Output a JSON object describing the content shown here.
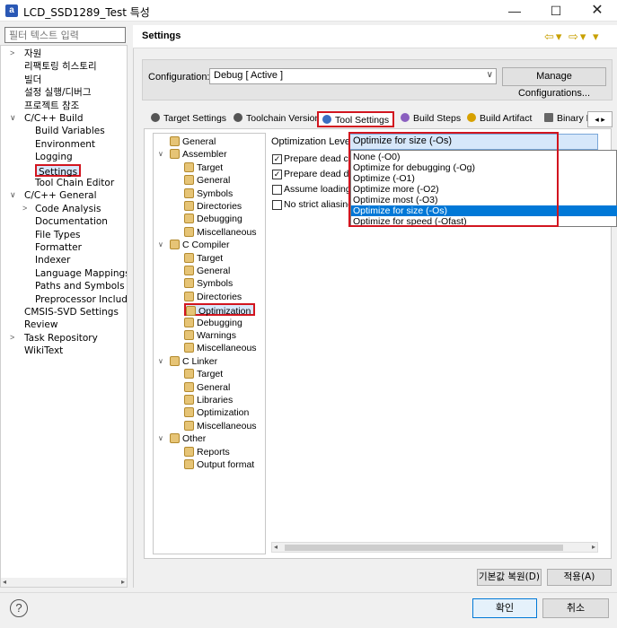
{
  "window": {
    "title": "LCD_SSD1289_Test 특성",
    "min_glyph": "—",
    "max_glyph": "☐",
    "close_glyph": "✕",
    "app_icon_glyph": "a"
  },
  "nav": {
    "filter_placeholder": "필터 텍스트 입력",
    "items": [
      {
        "label": "자원",
        "arrow": ">"
      },
      {
        "label": "리팩토링 히스토리",
        "arrow": ""
      },
      {
        "label": "빌더",
        "arrow": ""
      },
      {
        "label": "설정 실행/디버그",
        "arrow": ""
      },
      {
        "label": "프로젝트 참조",
        "arrow": ""
      },
      {
        "label": "C/C++ Build",
        "arrow": "∨"
      },
      {
        "label": "Build Variables",
        "arrow": ""
      },
      {
        "label": "Environment",
        "arrow": ""
      },
      {
        "label": "Logging",
        "arrow": ""
      },
      {
        "label": "Settings",
        "arrow": ""
      },
      {
        "label": "Tool Chain Editor",
        "arrow": ""
      },
      {
        "label": "C/C++ General",
        "arrow": "∨"
      },
      {
        "label": "Code Analysis",
        "arrow": ">"
      },
      {
        "label": "Documentation",
        "arrow": ""
      },
      {
        "label": "File Types",
        "arrow": ""
      },
      {
        "label": "Formatter",
        "arrow": ""
      },
      {
        "label": "Indexer",
        "arrow": ""
      },
      {
        "label": "Language Mappings",
        "arrow": ""
      },
      {
        "label": "Paths and Symbols",
        "arrow": ""
      },
      {
        "label": "Preprocessor Include P",
        "arrow": ""
      },
      {
        "label": "CMSIS-SVD Settings",
        "arrow": ""
      },
      {
        "label": "Review",
        "arrow": ""
      },
      {
        "label": "Task Repository",
        "arrow": ">"
      },
      {
        "label": "WikiText",
        "arrow": ""
      }
    ]
  },
  "header": {
    "title": "Settings",
    "nav_glyphs": "⇦▾ ⇨▾ ▾"
  },
  "config": {
    "label": "Configuration:",
    "value": "Debug  [ Active ]",
    "chevron": "∨",
    "manage_label": "Manage Configurations..."
  },
  "tabs": [
    {
      "label": "Target Settings"
    },
    {
      "label": "Toolchain Version"
    },
    {
      "label": "Tool Settings"
    },
    {
      "label": "Build Steps"
    },
    {
      "label": "Build Artifact"
    },
    {
      "label": "Binary P"
    }
  ],
  "tab_scroll": "◂ ▸",
  "tree": {
    "items": [
      {
        "label": "General",
        "caret": ""
      },
      {
        "label": "Assembler",
        "caret": "∨"
      },
      {
        "label": "Target",
        "caret": ""
      },
      {
        "label": "General",
        "caret": ""
      },
      {
        "label": "Symbols",
        "caret": ""
      },
      {
        "label": "Directories",
        "caret": ""
      },
      {
        "label": "Debugging",
        "caret": ""
      },
      {
        "label": "Miscellaneous",
        "caret": ""
      },
      {
        "label": "C Compiler",
        "caret": "∨"
      },
      {
        "label": "Target",
        "caret": ""
      },
      {
        "label": "General",
        "caret": ""
      },
      {
        "label": "Symbols",
        "caret": ""
      },
      {
        "label": "Directories",
        "caret": ""
      },
      {
        "label": "Optimization",
        "caret": ""
      },
      {
        "label": "Debugging",
        "caret": ""
      },
      {
        "label": "Warnings",
        "caret": ""
      },
      {
        "label": "Miscellaneous",
        "caret": ""
      },
      {
        "label": "C Linker",
        "caret": "∨"
      },
      {
        "label": "Target",
        "caret": ""
      },
      {
        "label": "General",
        "caret": ""
      },
      {
        "label": "Libraries",
        "caret": ""
      },
      {
        "label": "Optimization",
        "caret": ""
      },
      {
        "label": "Miscellaneous",
        "caret": ""
      },
      {
        "label": "Other",
        "caret": "∨"
      },
      {
        "label": "Reports",
        "caret": ""
      },
      {
        "label": "Output format",
        "caret": ""
      }
    ]
  },
  "options": {
    "level_label": "Optimization Level",
    "selected": "Optimize for size (-Os)",
    "dropdown": [
      "None (-O0)",
      "Optimize for debugging (-Og)",
      "Optimize (-O1)",
      "Optimize more (-O2)",
      "Optimize most (-O3)",
      "Optimize for size (-Os)",
      "Optimize for speed (-Ofast)"
    ],
    "checkboxes": [
      {
        "label": "Prepare dead cod",
        "checked": true
      },
      {
        "label": "Prepare dead dat",
        "checked": true
      },
      {
        "label": "Assume loading",
        "checked": false
      },
      {
        "label": "No strict aliasing",
        "checked": false
      }
    ],
    "check_glyph": "✓"
  },
  "buttons": {
    "restore": "기본값 복원(D)",
    "apply": "적용(A)",
    "ok": "확인",
    "cancel": "취소",
    "help": "?"
  },
  "scroll": {
    "left": "◂",
    "right": "▸"
  }
}
